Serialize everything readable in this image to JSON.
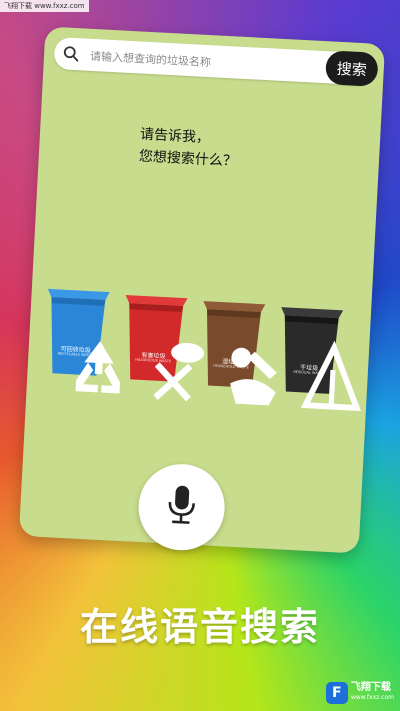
{
  "top_url": "飞翔下载 www.fxxz.com",
  "search": {
    "placeholder": "请输入想查询的垃圾名称",
    "button_label": "搜索"
  },
  "prompt": {
    "line1": "请告诉我，",
    "line2": "您想搜索什么？"
  },
  "bins": [
    {
      "name": "可回收垃圾",
      "sub": "RECYCLABLE WASTE",
      "color": "#2c86d8",
      "lid": "#3a98e6",
      "icon": "recycle-icon"
    },
    {
      "name": "有害垃圾",
      "sub": "HAZARDOUS WASTE",
      "color": "#d22a2a",
      "lid": "#e23a3a",
      "icon": "hazard-icon"
    },
    {
      "name": "湿垃圾",
      "sub": "HOUSEHOLD WASTE",
      "color": "#7a4a2c",
      "lid": "#8e5a38",
      "icon": "food-waste-icon"
    },
    {
      "name": "干垃圾",
      "sub": "RESIDUAL WASTE",
      "color": "#2a2a2a",
      "lid": "#3a3a3a",
      "icon": "residual-icon"
    }
  ],
  "banner": "在线语音搜索",
  "watermark": {
    "name": "飞翔下载",
    "url": "www.fxxz.com"
  }
}
